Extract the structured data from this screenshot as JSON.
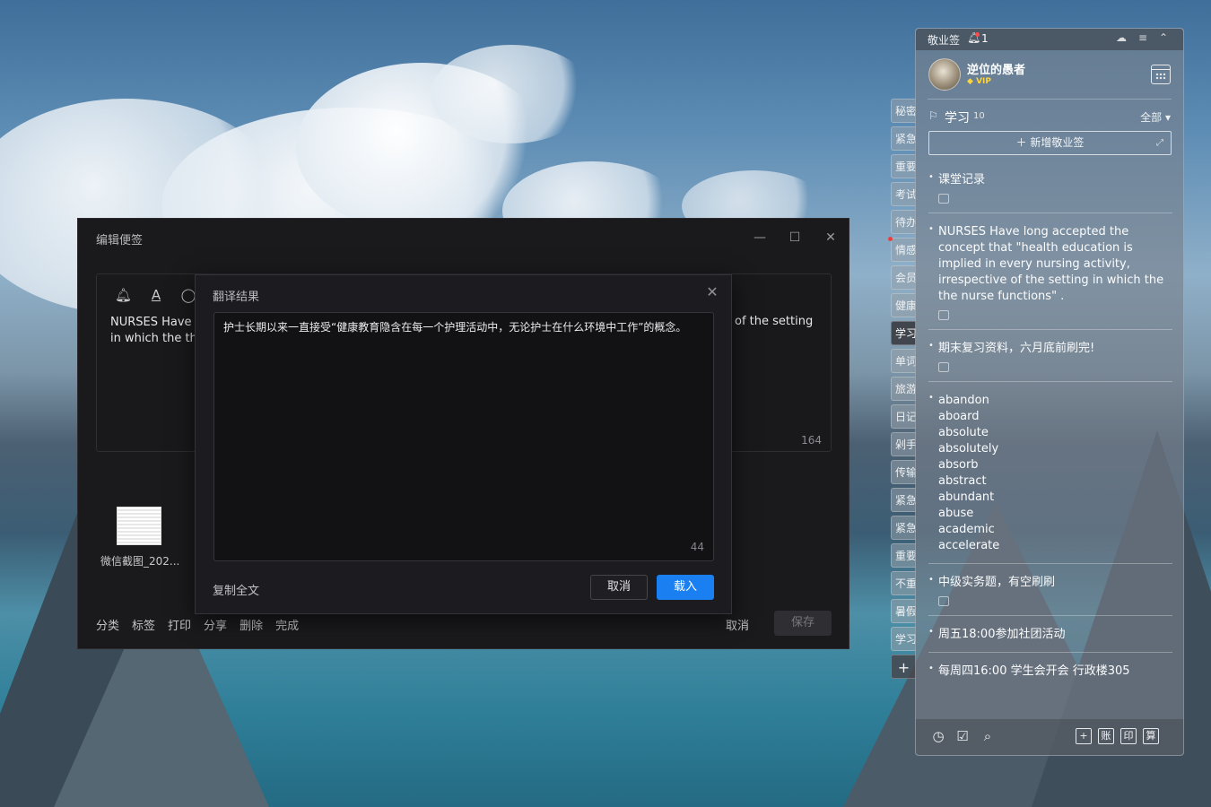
{
  "editor": {
    "title": "编辑便签",
    "minimize_icon": "minimize-icon",
    "maximize_icon": "maximize-icon",
    "close_icon": "close-icon",
    "toolbar_icons": [
      "bell-icon",
      "font-icon",
      "circle-icon"
    ],
    "note_text_line1": "NURSES Have l",
    "note_text_line2": "in which the th",
    "note_text_right": "of the setting",
    "char_count": "164",
    "attachment_name": "微信截图_202...",
    "actions": [
      "分类",
      "标签",
      "打印",
      "分享",
      "删除",
      "完成"
    ],
    "cancel_label": "取消",
    "save_label": "保存"
  },
  "translate_dialog": {
    "title": "翻译结果",
    "close_icon": "close-icon",
    "result_text": "护士长期以来一直接受“健康教育隐含在每一个护理活动中，无论护士在什么环境中工作”的概念。",
    "char_count": "44",
    "copy_all_label": "复制全文",
    "cancel_label": "取消",
    "load_label": "载入",
    "accent_color": "#1a7ff0"
  },
  "side_tabs": [
    {
      "label": "秘密"
    },
    {
      "label": "紧急"
    },
    {
      "label": "重要"
    },
    {
      "label": "考试"
    },
    {
      "label": "待办"
    },
    {
      "label": "情感"
    },
    {
      "label": "会员"
    },
    {
      "label": "健康"
    },
    {
      "label": "学习",
      "active": true
    },
    {
      "label": "单词"
    },
    {
      "label": "旅游"
    },
    {
      "label": "日记"
    },
    {
      "label": "剁手"
    },
    {
      "label": "传输"
    },
    {
      "label": "紧急"
    },
    {
      "label": "紧急"
    },
    {
      "label": "重要"
    },
    {
      "label": "不重"
    },
    {
      "label": "暑假"
    },
    {
      "label": "学习"
    }
  ],
  "add_tab_label": "+",
  "panel": {
    "app_name": "敬业签",
    "notification_count": "1",
    "header_icons": [
      "cloud-sync-icon",
      "menu-icon",
      "collapse-icon"
    ],
    "username": "逆位的愚者",
    "vip_label": "VIP",
    "calendar_icon": "calendar-icon",
    "category_name": "学习",
    "category_count": "10",
    "filter_label": "全部",
    "new_note_label": "新增敬业签",
    "notes": [
      {
        "text": "课堂记录",
        "has_sub": true
      },
      {
        "text": "NURSES Have long accepted the concept that \"health education is implied in every nursing activity, irrespective of the setting in which the the nurse functions\" .",
        "has_sub": true
      },
      {
        "text": "期末复习资料，六月底前刷完!",
        "has_sub": true
      },
      {
        "text": "abandon\naboard\nabsolute\nabsolutely\nabsorb\nabstract\nabundant\nabuse\nacademic\naccelerate",
        "has_sub": false
      },
      {
        "text": "中级实务题，有空刷刷",
        "has_sub": true
      },
      {
        "text": "周五18:00参加社团活动",
        "has_sub": false
      },
      {
        "text": "每周四16:00 学生会开会 行政楼305",
        "has_sub": false
      }
    ],
    "footer_icons": [
      "clock-icon",
      "checklist-icon",
      "search-icon"
    ],
    "footer_buttons": [
      "+",
      "账",
      "印",
      "算"
    ]
  }
}
